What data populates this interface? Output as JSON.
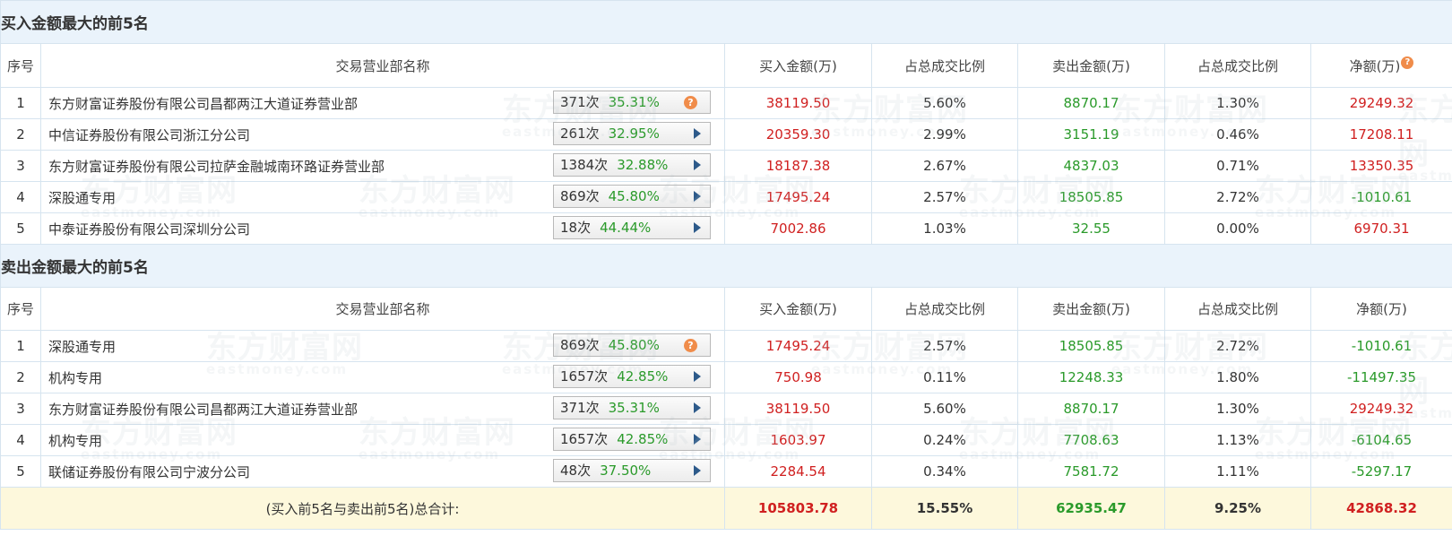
{
  "watermark": {
    "cn": "东方财富网",
    "en": "eastmoney.com"
  },
  "buy_section": {
    "title": "买入金额最大的前5名",
    "headers": [
      "序号",
      "交易营业部名称",
      "买入金额(万)",
      "占总成交比例",
      "卖出金额(万)",
      "占总成交比例",
      "净额(万)"
    ],
    "net_help_icon": "question-icon",
    "rows": [
      {
        "idx": "1",
        "name": "东方财富证券股份有限公司昌都两江大道证券营业部",
        "count": "371次",
        "pct": "35.31%",
        "badge_icon": "question-icon",
        "buy": "38119.50",
        "buy_ratio": "5.60%",
        "sell": "8870.17",
        "sell_ratio": "1.30%",
        "net": "29249.32"
      },
      {
        "idx": "2",
        "name": "中信证券股份有限公司浙江分公司",
        "count": "261次",
        "pct": "32.95%",
        "badge_icon": "play-icon",
        "buy": "20359.30",
        "buy_ratio": "2.99%",
        "sell": "3151.19",
        "sell_ratio": "0.46%",
        "net": "17208.11"
      },
      {
        "idx": "3",
        "name": "东方财富证券股份有限公司拉萨金融城南环路证券营业部",
        "count": "1384次",
        "pct": "32.88%",
        "badge_icon": "play-icon",
        "buy": "18187.38",
        "buy_ratio": "2.67%",
        "sell": "4837.03",
        "sell_ratio": "0.71%",
        "net": "13350.35"
      },
      {
        "idx": "4",
        "name": "深股通专用",
        "count": "869次",
        "pct": "45.80%",
        "badge_icon": "play-icon",
        "buy": "17495.24",
        "buy_ratio": "2.57%",
        "sell": "18505.85",
        "sell_ratio": "2.72%",
        "net": "-1010.61"
      },
      {
        "idx": "5",
        "name": "中泰证券股份有限公司深圳分公司",
        "count": "18次",
        "pct": "44.44%",
        "badge_icon": "play-icon",
        "buy": "7002.86",
        "buy_ratio": "1.03%",
        "sell": "32.55",
        "sell_ratio": "0.00%",
        "net": "6970.31"
      }
    ]
  },
  "sell_section": {
    "title": "卖出金额最大的前5名",
    "headers": [
      "序号",
      "交易营业部名称",
      "买入金额(万)",
      "占总成交比例",
      "卖出金额(万)",
      "占总成交比例",
      "净额(万)"
    ],
    "rows": [
      {
        "idx": "1",
        "name": "深股通专用",
        "count": "869次",
        "pct": "45.80%",
        "badge_icon": "question-icon",
        "buy": "17495.24",
        "buy_ratio": "2.57%",
        "sell": "18505.85",
        "sell_ratio": "2.72%",
        "net": "-1010.61"
      },
      {
        "idx": "2",
        "name": "机构专用",
        "count": "1657次",
        "pct": "42.85%",
        "badge_icon": "play-icon",
        "buy": "750.98",
        "buy_ratio": "0.11%",
        "sell": "12248.33",
        "sell_ratio": "1.80%",
        "net": "-11497.35"
      },
      {
        "idx": "3",
        "name": "东方财富证券股份有限公司昌都两江大道证券营业部",
        "count": "371次",
        "pct": "35.31%",
        "badge_icon": "play-icon",
        "buy": "38119.50",
        "buy_ratio": "5.60%",
        "sell": "8870.17",
        "sell_ratio": "1.30%",
        "net": "29249.32"
      },
      {
        "idx": "4",
        "name": "机构专用",
        "count": "1657次",
        "pct": "42.85%",
        "badge_icon": "play-icon",
        "buy": "1603.97",
        "buy_ratio": "0.24%",
        "sell": "7708.63",
        "sell_ratio": "1.13%",
        "net": "-6104.65"
      },
      {
        "idx": "5",
        "name": "联储证券股份有限公司宁波分公司",
        "count": "48次",
        "pct": "37.50%",
        "badge_icon": "play-icon",
        "buy": "2284.54",
        "buy_ratio": "0.34%",
        "sell": "7581.72",
        "sell_ratio": "1.11%",
        "net": "-5297.17"
      }
    ]
  },
  "total": {
    "label": "(买入前5名与卖出前5名)总合计:",
    "buy": "105803.78",
    "buy_ratio": "15.55%",
    "sell": "62935.47",
    "sell_ratio": "9.25%",
    "net": "42868.32"
  },
  "colors": {
    "positive": "#d02020",
    "negative": "#2a9a2a",
    "header_bg": "#eaf3fb",
    "total_bg": "#fdf8dc",
    "border": "#d6e4ef"
  }
}
